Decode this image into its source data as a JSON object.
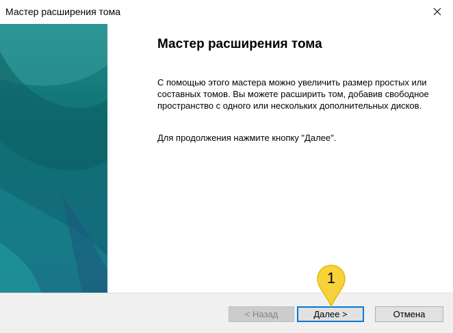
{
  "window": {
    "title": "Мастер расширения тома"
  },
  "content": {
    "heading": "Мастер расширения тома",
    "paragraph1": "С помощью этого мастера можно увеличить размер простых или составных томов. Вы можете расширить том, добавив свободное пространство с одного или нескольких дополнительных дисков.",
    "paragraph2": "Для продолжения нажмите кнопку \"Далее\"."
  },
  "buttons": {
    "back_label": "< Назад",
    "next_label": "Далее >",
    "cancel_label": "Отмена"
  },
  "annotation": {
    "step_number": "1",
    "color": "#f5d020"
  },
  "colors": {
    "side_panel": "#0f6f72",
    "focus_border": "#0078d7"
  },
  "icons": {
    "close": "close-icon"
  }
}
